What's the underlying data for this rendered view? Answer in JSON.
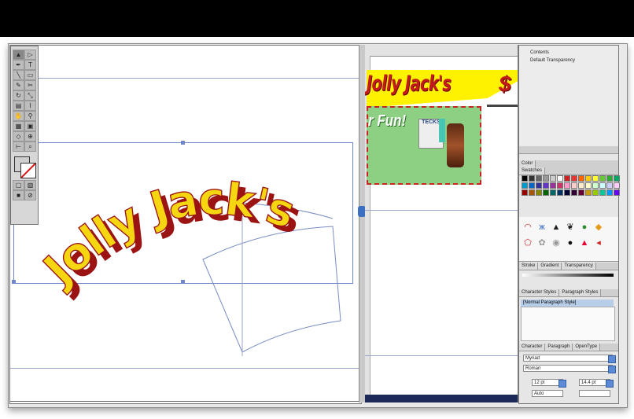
{
  "headline": {
    "word1": "Jolly",
    "word2": "Jack's"
  },
  "preview": {
    "banner_text": "Jolly Jack's",
    "dollar_text": "$",
    "promo_text": "r Fun!",
    "pack_label": "TECKS"
  },
  "panels": {
    "menu_items": [
      "Contents",
      "Default Transparency"
    ],
    "color_tab": "Color",
    "swatches_tab": "Swatches",
    "gradient_tabs": [
      "Stroke",
      "Gradient",
      "Transparency"
    ],
    "style_tabs": [
      "Character Styles",
      "Paragraph Styles"
    ],
    "selected_style": "[Normal Paragraph Style]",
    "char_tabs": [
      "Character",
      "Paragraph",
      "OpenType"
    ],
    "font_name": "Myriad",
    "font_style": "Roman",
    "font_size": "12 pt",
    "leading": "14.4 pt",
    "kerning": "Auto"
  },
  "colors": {
    "headline_fill": "#f5d611",
    "headline_shadow": "#9b1313",
    "selection": "#6f86c9",
    "promo_bg": "#8ed083",
    "banner_red": "#c51a1a"
  },
  "icons": [
    "selection-tool-icon",
    "type-tool-icon",
    "pen-tool-icon",
    "rotate-tool-icon",
    "zoom-tool-icon",
    "hand-tool-icon",
    "fill-stroke-icon",
    "butterfly-symbol-icon",
    "fish-symbol-icon",
    "eye-symbol-icon"
  ]
}
